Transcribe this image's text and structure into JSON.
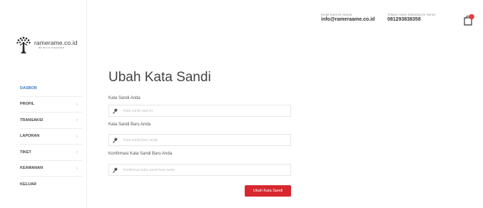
{
  "brand": {
    "name": "ramerame.co.id",
    "tagline": "BE BUILD TOGETHER"
  },
  "header": {
    "email_label": "Email Kami Di Alamat",
    "email": "info@rameraame.co.id",
    "phone_label": "Telepon Kami Sekarang Di Nomor",
    "phone": "081293838358",
    "cart_icon": "shopping-bag-icon",
    "cart_badge_color": "#e83c3c"
  },
  "sidebar": {
    "items": [
      {
        "label": "DASBOR",
        "active": true
      },
      {
        "label": "PROFIL",
        "chevron": "›"
      },
      {
        "label": "TRANSAKSI",
        "chevron": "›"
      },
      {
        "label": "LAPORAN",
        "chevron": "›"
      },
      {
        "label": "TIKET",
        "chevron": "›"
      },
      {
        "label": "KEAMANAN",
        "chevron": "›"
      },
      {
        "label": "KELUAR"
      }
    ]
  },
  "form": {
    "title": "Ubah Kata Sandi",
    "fields": [
      {
        "label": "Kata Sandi Anda",
        "placeholder": "Kata sandi saat ini",
        "value": ""
      },
      {
        "label": "Kata Sandi Baru Anda",
        "placeholder": "Kata sandi baru anda",
        "value": ""
      },
      {
        "label": "Konfirmasi Kata Sandi Baru Anda",
        "placeholder": "Konfirmasi kata sandi baru anda",
        "value": ""
      }
    ],
    "submit_label": "Ubah Kata Sandi",
    "field_icon": "key-icon",
    "accent_color": "#d7282f"
  }
}
